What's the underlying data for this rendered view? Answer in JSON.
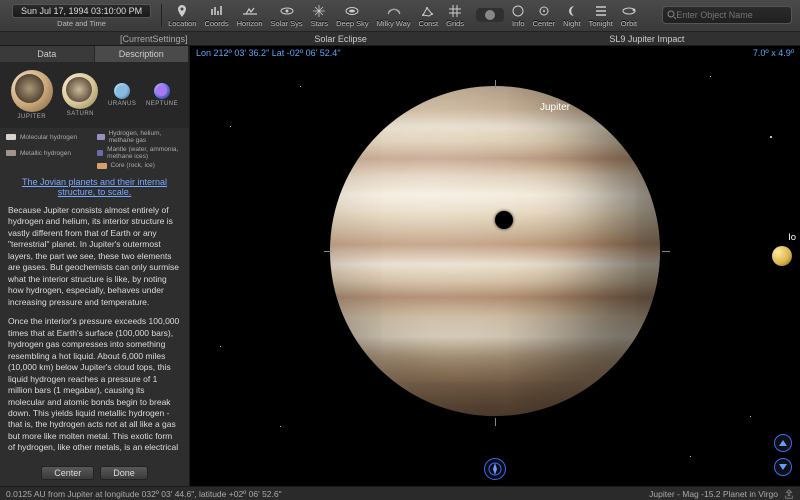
{
  "toolbar": {
    "datetime": "Sun Jul 17, 1994  03:10:00 PM",
    "datetime_label": "Date and Time",
    "items": [
      {
        "name": "location",
        "label": "Location",
        "icon": "pin"
      },
      {
        "name": "coords",
        "label": "Coords",
        "icon": "bars"
      },
      {
        "name": "horizon",
        "label": "Horizon",
        "icon": "horizon"
      },
      {
        "name": "solarsys",
        "label": "Solar Sys",
        "icon": "orbit"
      },
      {
        "name": "stars",
        "label": "Stars",
        "icon": "sparkle"
      },
      {
        "name": "deepsky",
        "label": "Deep Sky",
        "icon": "galaxy"
      },
      {
        "name": "milkyway",
        "label": "Milky Way",
        "icon": "milky"
      },
      {
        "name": "const",
        "label": "Const",
        "icon": "const"
      },
      {
        "name": "grids",
        "label": "Grids",
        "icon": "grid"
      },
      {
        "name": "blank",
        "label": "",
        "icon": "pill"
      },
      {
        "name": "info",
        "label": "Info",
        "icon": "info"
      },
      {
        "name": "center",
        "label": "Center",
        "icon": "target"
      },
      {
        "name": "night",
        "label": "Night",
        "icon": "moon"
      },
      {
        "name": "tonight",
        "label": "Tonight",
        "icon": "list"
      },
      {
        "name": "orbit",
        "label": "Orbit",
        "icon": "orbit2"
      }
    ],
    "search_placeholder": "Enter Object Name",
    "search_label": "Search"
  },
  "settings_strip": {
    "current": "[CurrentSettings]",
    "tabs": [
      "Solar Eclipse",
      "SL9 Jupiter Impact"
    ]
  },
  "sidebar": {
    "tabs": {
      "data": "Data",
      "description": "Description"
    },
    "active_tab": "description",
    "planets": [
      {
        "name": "jupiter",
        "label": "JUPITER"
      },
      {
        "name": "saturn",
        "label": "SATURN"
      },
      {
        "name": "uranus",
        "label": "URANUS"
      },
      {
        "name": "neptune",
        "label": "NEPTUNE"
      }
    ],
    "legend": [
      {
        "color": "#d8d2c8",
        "label": "Molecular hydrogen"
      },
      {
        "color": "#9a8fbf",
        "label": "Hydrogen, helium, methane gas"
      },
      {
        "color": "#a09488",
        "label": "Metallic hydrogen"
      },
      {
        "color": "#6d6aa8",
        "label": "Mantle (water, ammonia, methane ices)"
      },
      {
        "color": "#d7a06a",
        "label": "Core (rock, ice)"
      }
    ],
    "link_title": "The Jovian planets and their internal structure, to scale.",
    "para1": "Because Jupiter consists almost entirely of hydrogen and helium, its interior structure is vastly different from that of Earth or any \"terrestrial\" planet. In Jupiter's outermost layers, the part we see, these two elements are gases. But geochemists can only surmise what the interior structure is like, by noting how hydrogen, especially, behaves under increasing pressure and temperature.",
    "para2": "Once the interior's pressure exceeds 100,000 times that at Earth's surface (100,000 bars), hydrogen gas compresses into something resembling a hot liquid. About 6,000 miles (10,000 km) below Jupiter's cloud tops, this liquid hydrogen reaches a pressure of 1 million bars (1 megabar), causing its molecular and atomic bonds begin to break down. This yields liquid metallic hydrogen - that is, the hydrogen acts not at all like a gas but more like molten metal. This exotic form of hydrogen, like other metals, is an electrical",
    "buttons": {
      "center": "Center",
      "done": "Done"
    }
  },
  "sky": {
    "coords": "Lon 212º 03' 36.2\" Lat -02º 06' 52.4\"",
    "fov": "7.0º  x  4.9º",
    "labels": {
      "jupiter": "Jupiter",
      "io": "Io"
    }
  },
  "status": {
    "left": "0.0125 AU from Jupiter at longitude 032º 03' 44.6\", latitude +02º 06' 52.6\"",
    "right": "Jupiter - Mag  -15.2 Planet in Virgo"
  }
}
